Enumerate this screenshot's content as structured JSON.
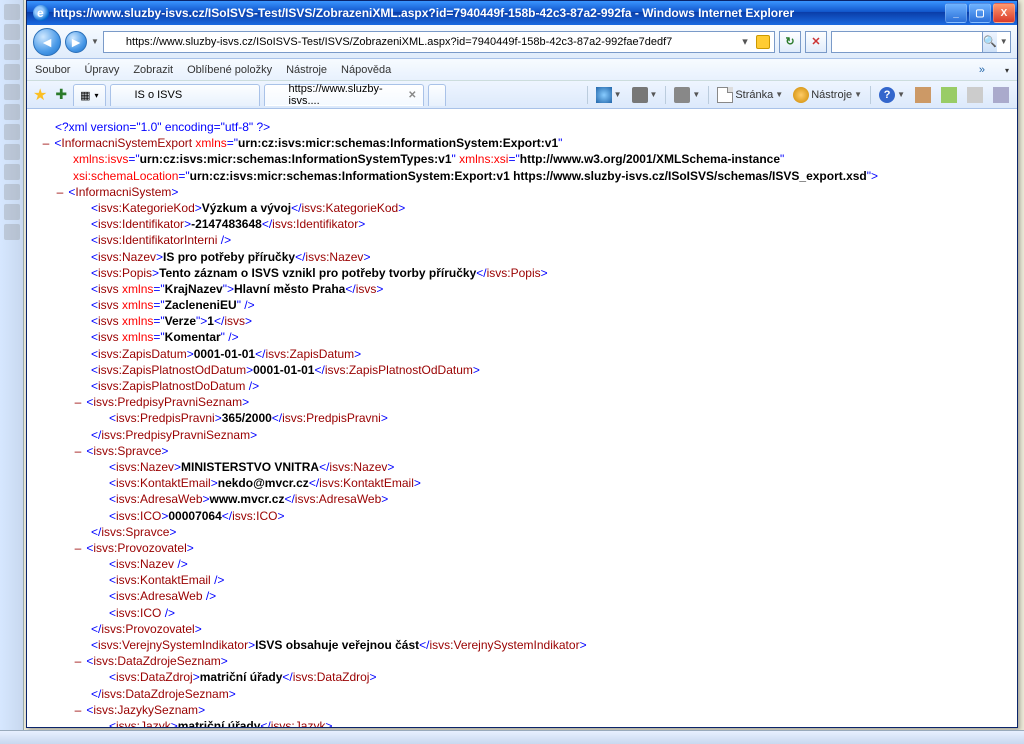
{
  "window": {
    "title": "https://www.sluzby-isvs.cz/ISoISVS-Test/ISVS/ZobrazeniXML.aspx?id=7940449f-158b-42c3-87a2-992fa - Windows Internet Explorer"
  },
  "address": {
    "url": "https://www.sluzby-isvs.cz/ISoISVS-Test/ISVS/ZobrazeniXML.aspx?id=7940449f-158b-42c3-87a2-992fae7dedf7"
  },
  "menu": {
    "items": [
      "Soubor",
      "Úpravy",
      "Zobrazit",
      "Oblíbené položky",
      "Nástroje",
      "Nápověda"
    ]
  },
  "tabs": {
    "t1": "IS o ISVS",
    "t2": "https://www.sluzby-isvs...."
  },
  "toolbar": {
    "stranka": "Stránka",
    "nastroje": "Nástroje"
  },
  "xml": {
    "decl": "<?xml version=\"1.0\" encoding=\"utf-8\" ?>",
    "root": "InformacniSystemExport",
    "xmlns": "urn:cz:isvs:micr:schemas:InformationSystem:Export:v1",
    "xmlns_isvs": "urn:cz:isvs:micr:schemas:InformationSystemTypes:v1",
    "xmlns_xsi": "http://www.w3.org/2001/XMLSchema-instance",
    "schemaLoc": "urn:cz:isvs:micr:schemas:InformationSystem:Export:v1 https://www.sluzby-isvs.cz/ISoISVS/schemas/ISVS_export.xsd",
    "is": "InformacniSystem",
    "kategorieKod": "Výzkum a vývoj",
    "identifikator": "-2147483648",
    "nazev": "IS pro potřeby příručky",
    "popis": "Tento záznam o ISVS vznikl pro potřeby tvorby příručky",
    "krajNazev_attr": "KrajNazev",
    "krajNazev_val": "Hlavní město Praha",
    "zacleneniEU_attr": "ZacleneniEU",
    "verze_attr": "Verze",
    "verze_val": "1",
    "komentar_attr": "Komentar",
    "zapisDatum": "0001-01-01",
    "zapisPlatnostOd": "0001-01-01",
    "predpis": "365/2000",
    "spravce_nazev": "MINISTERSTVO VNITRA",
    "spravce_email": "nekdo@mvcr.cz",
    "spravce_web": "www.mvcr.cz",
    "spravce_ico": "00007064",
    "verejny": "ISVS obsahuje veřejnou část",
    "dataZdroj": "matriční úřady",
    "jazyk": "matriční úřady"
  }
}
